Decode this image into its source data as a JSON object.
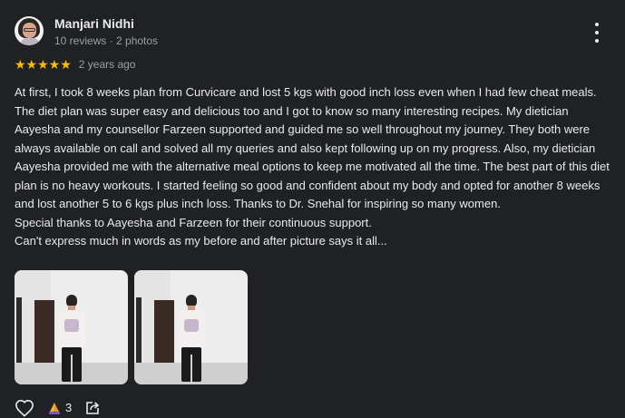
{
  "reviewer": {
    "name": "Manjari Nidhi",
    "meta": "10 reviews · 2 photos"
  },
  "rating": {
    "stars_text": "★★★★★",
    "value": 5,
    "age": "2 years ago"
  },
  "review": {
    "paragraph_1": "At first, I took 8 weeks plan from Curvicare and lost 5 kgs with good inch loss even when I had few cheat meals. The diet plan was super easy and delicious too and I got to know so many interesting recipes. My dietician Aayesha and my counsellor Farzeen supported and guided me so well throughout my journey. They both were always available on call and solved all my queries and also kept following up on my progress. Also, my dietician Aayesha provided me with the alternative meal options to keep me motivated all the time. The best part of this diet plan is no heavy workouts. I started feeling so good and confident about my body and opted for another 8 weeks and lost another 5 to 6 kgs plus inch loss. Thanks to Dr. Snehal for inspiring so many women.",
    "paragraph_2": "Special thanks to Aayesha and Farzeen for their continuous support.",
    "paragraph_3": "Can't express much in words as my before and after picture says it all..."
  },
  "photos": [
    {
      "subject": "before-photo"
    },
    {
      "subject": "after-photo"
    }
  ],
  "actions": {
    "like_icon": "heart-icon",
    "reaction_icon": "praying-hands-icon",
    "reaction_count": "3",
    "share_icon": "share-icon"
  },
  "colors": {
    "background": "#202124",
    "star": "#fbbc04",
    "text": "#e8eaed",
    "muted": "#9aa0a6"
  }
}
